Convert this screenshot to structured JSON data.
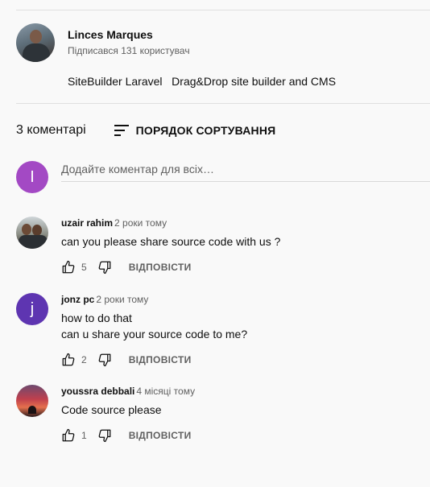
{
  "channel": {
    "name": "Linces Marques",
    "subscribers": "Підписався 131 користувач",
    "avatar_icon": "channel-avatar-photo"
  },
  "description": "SiteBuilder Laravel   Drag&Drop site builder and CMS",
  "comments_header": {
    "count": "3 коментарі",
    "sort_label": "ПОРЯДОК СОРТУВАННЯ",
    "sort_icon": "sort-icon"
  },
  "add_comment": {
    "avatar_letter": "I",
    "avatar_color": "#a349c4",
    "placeholder": "Додайте коментар для всіх…"
  },
  "comments": [
    {
      "author": "uzair rahim",
      "time": "2 роки тому",
      "text": "can you please share source code with us ?",
      "likes": "5",
      "reply": "ВІДПОВІСТИ",
      "avatar_icon": "photo-avatar"
    },
    {
      "author": "jonz pc",
      "time": "2 роки тому",
      "text": "how to do that\ncan u share your source code to me?",
      "likes": "2",
      "reply": "ВІДПОВІСТИ",
      "avatar_letter": "j",
      "avatar_color": "#5e35b1"
    },
    {
      "author": "youssra debbali",
      "time": "4 місяці тому",
      "text": "Code source please",
      "likes": "1",
      "reply": "ВІДПОВІСТИ",
      "avatar_icon": "sunset-photo-avatar"
    }
  ],
  "colors": {
    "background": "#f9f9f9",
    "text": "#0f0f0f",
    "secondary_text": "#606060",
    "divider": "#e0e0e0"
  }
}
